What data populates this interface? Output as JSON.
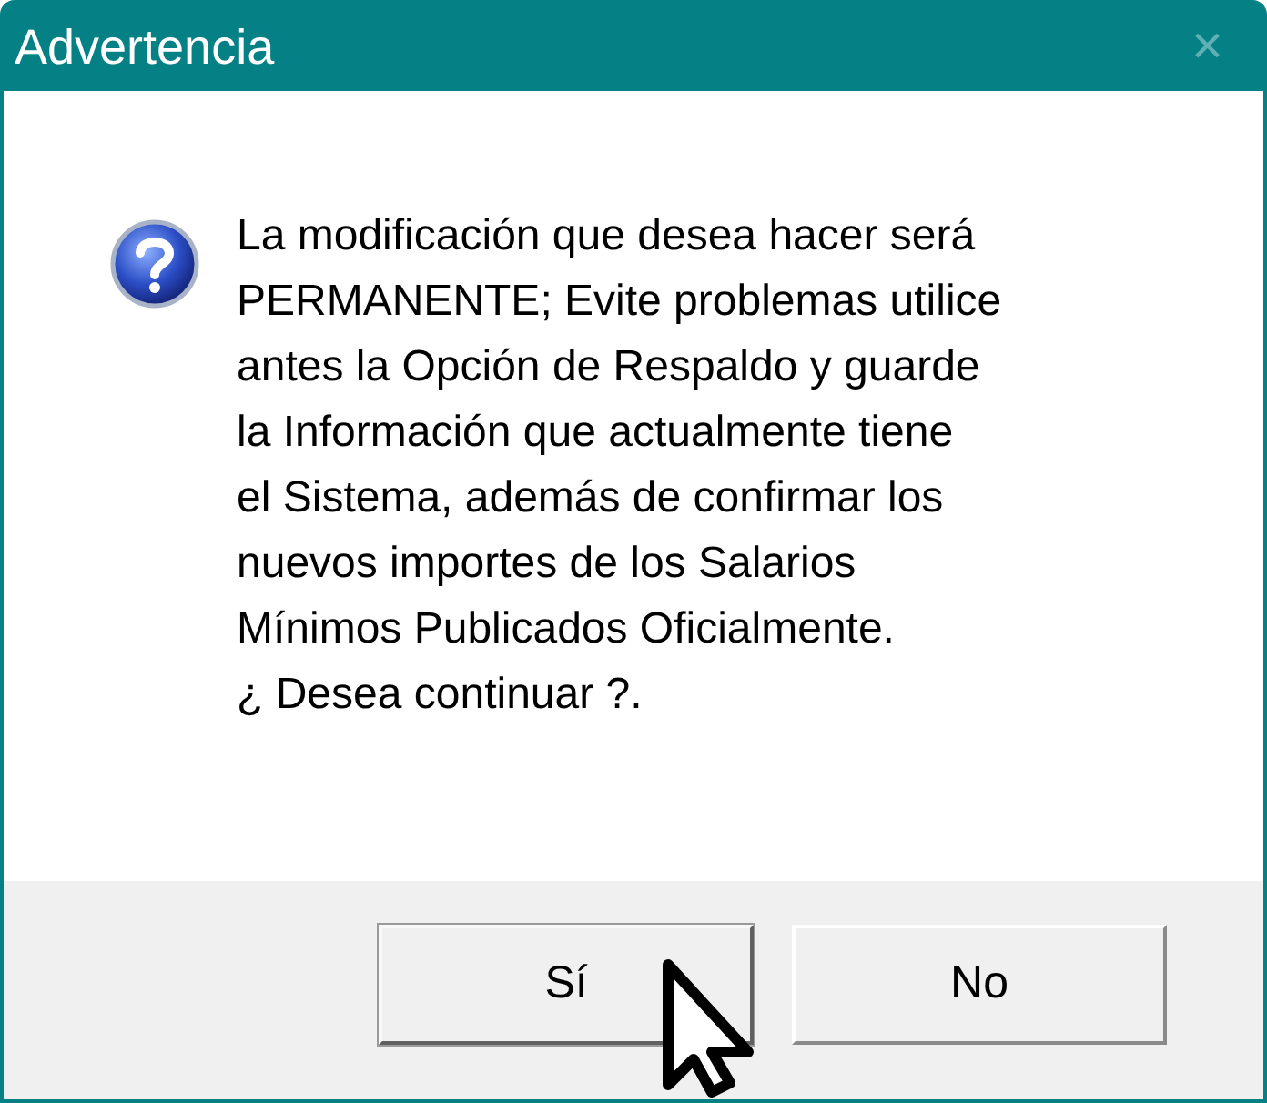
{
  "window": {
    "title": "Advertencia",
    "close": "×"
  },
  "message_lines": [
    "La modificación que desea hacer será",
    "PERMANENTE; Evite problemas utilice",
    "antes la Opción de Respaldo y guarde",
    "la Información que actualmente tiene",
    "el Sistema, además de confirmar los",
    "nuevos importes de los Salarios",
    "Mínimos Publicados Oficialmente.",
    "¿ Desea continuar ?."
  ],
  "buttons": [
    {
      "label": "Sí",
      "focused": true
    },
    {
      "label": "No",
      "focused": false
    }
  ]
}
